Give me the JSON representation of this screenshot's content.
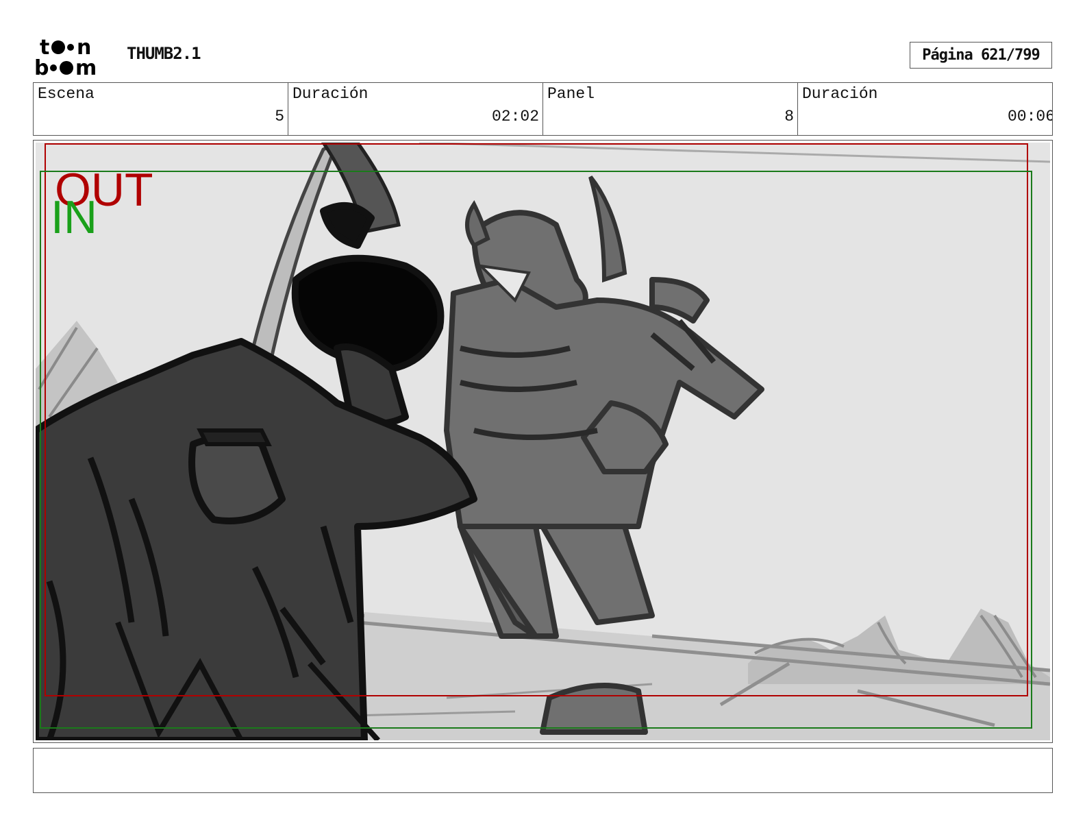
{
  "header": {
    "logo": "Toon Boom logo",
    "project_title": "THUMB2.1",
    "page_label": "Página 621/799"
  },
  "info": {
    "scene_label": "Escena",
    "scene_value": "5",
    "scene_duration_label": "Duración",
    "scene_duration_value": "02:02",
    "panel_label": "Panel",
    "panel_value": "8",
    "panel_duration_label": "Duración",
    "panel_duration_value": "00:06"
  },
  "panel": {
    "out_label": "OUT",
    "in_label": "IN",
    "out_color": "#b00000",
    "in_color": "#1aa01a",
    "background_color": "#e4e4e4"
  },
  "notes": {
    "text": ""
  }
}
